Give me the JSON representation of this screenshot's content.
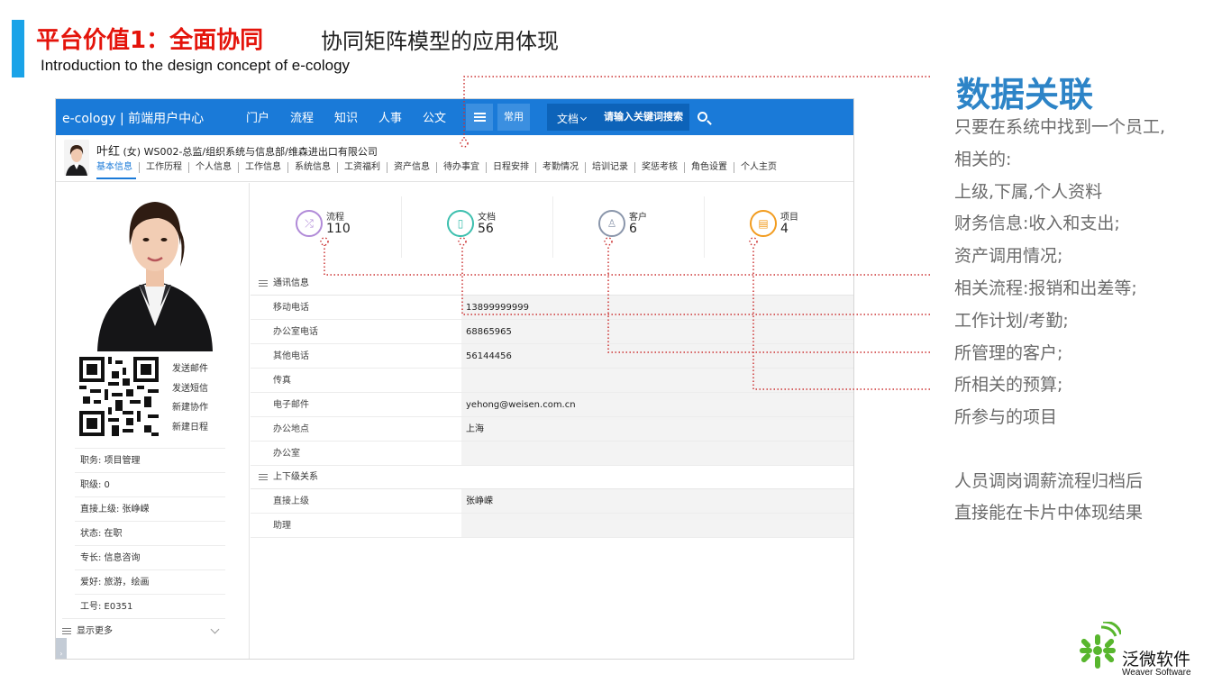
{
  "slide": {
    "title": "平台价值1：全面协同",
    "subtitle": "协同矩阵模型的应用体现",
    "intro": "Introduction to the design concept of e-cology"
  },
  "app": {
    "brand": "e-cology | 前端用户中心",
    "nav": [
      "门户",
      "流程",
      "知识",
      "人事",
      "公文"
    ],
    "common_label": "常用",
    "search": {
      "type": "文档",
      "placeholder": "请输入关键词搜索"
    },
    "user": {
      "name": "叶红",
      "gender": "(女)",
      "org": "WS002-总监/组织系统与信息部/维森进出口有限公司"
    },
    "tabs": [
      "基本信息",
      "工作历程",
      "个人信息",
      "工作信息",
      "系统信息",
      "工资福利",
      "资产信息",
      "待办事宜",
      "日程安排",
      "考勤情况",
      "培训记录",
      "奖惩考核",
      "角色设置",
      "个人主页"
    ],
    "qr_actions": [
      "发送邮件",
      "发送短信",
      "新建协作",
      "新建日程"
    ],
    "profile": [
      "职务: 项目管理",
      "职级: 0",
      "直接上级: 张峥嵘",
      "状态: 在职",
      "专长: 信息咨询",
      "爱好: 旅游，绘画",
      "工号: E0351"
    ],
    "show_more": "显示更多",
    "stats": [
      {
        "label": "流程",
        "value": "110",
        "icon": "shuffle-icon",
        "color": "#b18bd8"
      },
      {
        "label": "文档",
        "value": "56",
        "icon": "book-icon",
        "color": "#3cbfae"
      },
      {
        "label": "客户",
        "value": "6",
        "icon": "person-icon",
        "color": "#8a96ab"
      },
      {
        "label": "项目",
        "value": "4",
        "icon": "document-icon",
        "color": "#f29c1f"
      }
    ],
    "contact_section": "通讯信息",
    "contact": [
      {
        "label": "移动电话",
        "value": "13899999999"
      },
      {
        "label": "办公室电话",
        "value": "68865965"
      },
      {
        "label": "其他电话",
        "value": "56144456"
      },
      {
        "label": "传真",
        "value": ""
      },
      {
        "label": "电子邮件",
        "value": "yehong@weisen.com.cn"
      },
      {
        "label": "办公地点",
        "value": "上海"
      },
      {
        "label": "办公室",
        "value": ""
      }
    ],
    "relation_section": "上下级关系",
    "relations": [
      {
        "label": "直接上级",
        "value": "张峥嵘"
      },
      {
        "label": "助理",
        "value": ""
      }
    ]
  },
  "panel": {
    "title": "数据关联",
    "lines": [
      "只要在系统中找到一个员工,",
      "相关的:",
      "上级,下属,个人资料",
      "财务信息:收入和支出;",
      "资产调用情况;",
      "相关流程:报销和出差等;",
      "工作计划/考勤;",
      "所管理的客户;",
      "所相关的预算;",
      "所参与的项目"
    ],
    "note": [
      "人员调岗调薪流程归档后",
      "直接能在卡片中体现结果"
    ]
  },
  "logo": {
    "cn": "泛微软件",
    "en": "Weaver Software"
  },
  "colors": {
    "accent_bar": "#1aa3e8",
    "title_red": "#e4140b",
    "app_blue": "#1a7ad8",
    "panel_title": "#2d84c7",
    "connector": "#cc3333"
  }
}
